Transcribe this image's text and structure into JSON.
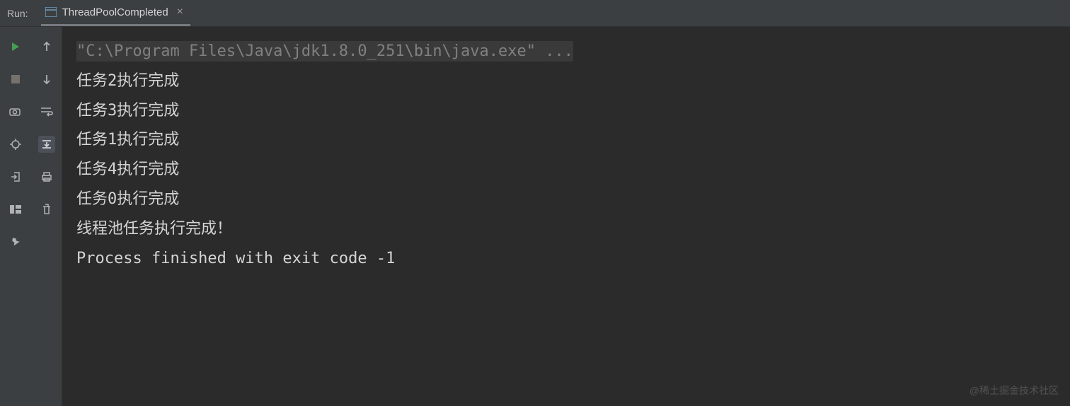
{
  "header": {
    "run_label": "Run:",
    "tab": {
      "title": "ThreadPoolCompleted",
      "close": "×"
    }
  },
  "console": {
    "command": "\"C:\\Program Files\\Java\\jdk1.8.0_251\\bin\\java.exe\" ...",
    "lines": [
      "任务2执行完成",
      "任务3执行完成",
      "任务1执行完成",
      "任务4执行完成",
      "任务0执行完成",
      "",
      "线程池任务执行完成！",
      "",
      "Process finished with exit code -1"
    ]
  },
  "watermark": "@稀土掘金技术社区"
}
